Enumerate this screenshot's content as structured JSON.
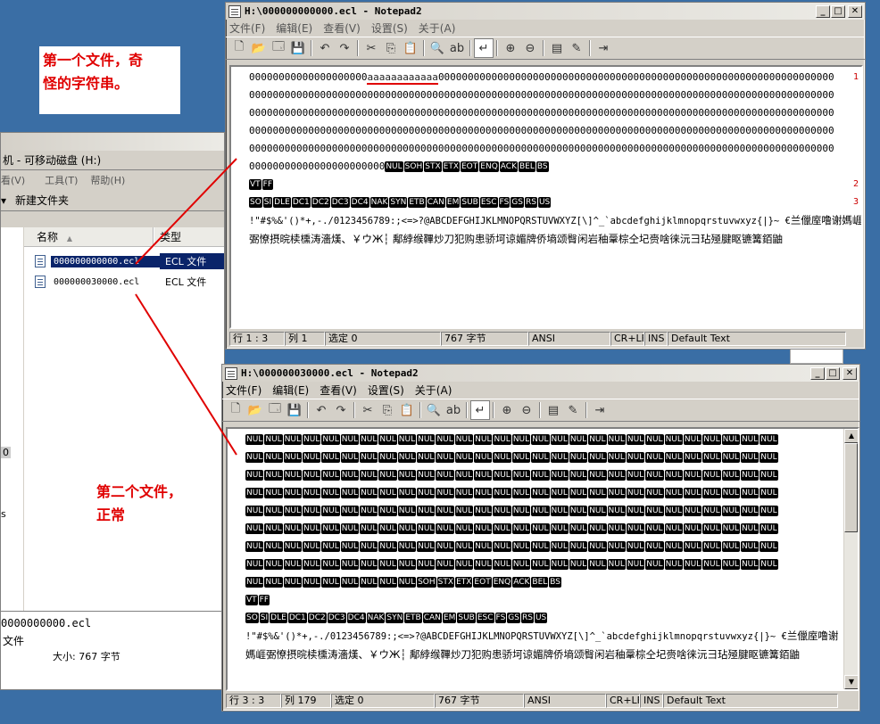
{
  "colors": {
    "desktop": "#3a6ea5",
    "accent_red": "#e00000",
    "selected": "#0a246a"
  },
  "note1": {
    "line1": "第一个文件，奇",
    "line2": "怪的字符串。"
  },
  "note2": {
    "line1": "第二个文件，",
    "line2": "正常"
  },
  "explorer": {
    "address": "机 - 可移动磁盘 (H:)",
    "menu": [
      "看(V)",
      "工具(T)",
      "帮助(H)"
    ],
    "new_folder": "新建文件夹",
    "col_name": "名称",
    "col_type": "类型",
    "files": [
      {
        "name": "000000000000.ecl",
        "type": "ECL 文件"
      },
      {
        "name": "000000030000.ecl",
        "type": "ECL 文件"
      }
    ],
    "side_chars": [
      "0",
      "s"
    ],
    "detail_name": "0000000000.ecl",
    "detail_type": "文件",
    "detail_size": "大小: 767 字节"
  },
  "np1": {
    "title": "H:\\000000000000.ecl - Notepad2",
    "menu": [
      "文件(F)",
      "编辑(E)",
      "查看(V)",
      "设置(S)",
      "关于(A)"
    ],
    "line1_a": "00000000000000000000",
    "line1_b": "aaaaaaaaaaaa",
    "line1_c": "0000000000000000000000000000000000000000000000000000000000000000000",
    "zero_row": "000000000000000000000000000000000000000000000000000000000000000000000000000000000000000000000000000",
    "last_zero": "00000000000000000000000",
    "ctrl_a": [
      "NUL",
      "SOH",
      "STX",
      "ETX",
      "EOT",
      "ENQ",
      "ACK",
      "BEL",
      "BS"
    ],
    "ctrl_b": [
      "VT",
      "FF"
    ],
    "ctrl_c": [
      "SO",
      "SI",
      "DLE",
      "DC1",
      "DC2",
      "DC3",
      "DC4",
      "NAK",
      "SYN",
      "ETB",
      "CAN",
      "EM",
      "SUB",
      "ESC",
      "FS",
      "GS",
      "RS",
      "US"
    ],
    "ascii": "!\"#$%&'()*+,-./0123456789:;<=>?@ABCDEFGHIJKLMNOPQRSTUVWXYZ[\\]^_`abcdefghijklmnopqrstuvwxyz{|}~ €",
    "garble": "兰儠庢噜谢媽崕弻憭摂晥椟櫄涛濇熯、￥ウЖ┆ 鄅綍缑鞸炒刀犯购患骄坷谅媚牌侨墒颂臀闲岩秞鞷棕仝圮赍啥徕沅彐玷殛腱眍镳篝銆鼬",
    "status": {
      "pos": "行 1 : 3",
      "col": "列 1",
      "sel": "选定 0",
      "size": "767 字节",
      "enc": "ANSI",
      "eol": "CR+LF",
      "ins": "INS",
      "scheme": "Default Text"
    }
  },
  "np2": {
    "title": "H:\\000000030000.ecl - Notepad2",
    "menu": [
      "文件(F)",
      "编辑(E)",
      "查看(V)",
      "设置(S)",
      "关于(A)"
    ],
    "nul": "NUL",
    "ctrl_tail": [
      "SOH",
      "STX",
      "ETX",
      "EOT",
      "ENQ",
      "ACK",
      "BEL",
      "BS"
    ],
    "ctrl_b": [
      "VT",
      "FF"
    ],
    "ctrl_c": [
      "SO",
      "SI",
      "DLE",
      "DC1",
      "DC2",
      "DC3",
      "DC4",
      "NAK",
      "SYN",
      "ETB",
      "CAN",
      "EM",
      "SUB",
      "ESC",
      "FS",
      "GS",
      "RS",
      "US"
    ],
    "ascii": "!\"#$%&'()*+,-./0123456789:;<=>?@ABCDEFGHIJKLMNOPQRSTUVWXYZ[\\]^_`abcdefghijklmnopqrstuvwxyz{|}~ €",
    "garble": "兰儠庢噜谢媽崕弻憭摂晥椟櫄涛濇熯、￥ウЖ┆ 鄅綍缑鞸炒刀犯购患骄坷谅媚牌侨墒颂臀闲岩秞鞷棕仝圮赍啥徕沅彐玷殛腱眍镳篝銆鼬",
    "status": {
      "pos": "行 3 : 3",
      "col": "列 179",
      "sel": "选定 0",
      "size": "767 字节",
      "enc": "ANSI",
      "eol": "CR+LF",
      "ins": "INS",
      "scheme": "Default Text"
    }
  },
  "line_numbers": {
    "one": "1",
    "two": "2",
    "three": "3"
  }
}
